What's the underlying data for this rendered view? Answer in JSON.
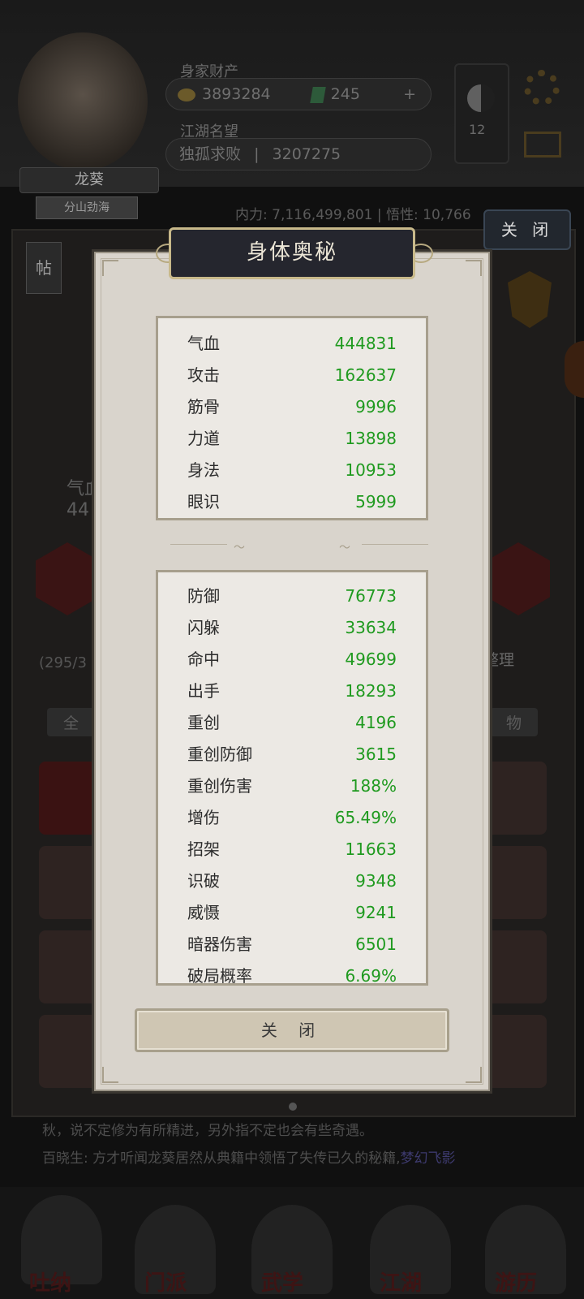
{
  "background": {
    "hero_name": "龙葵",
    "hero_tag": "分山劲海",
    "wealth_label": "身家财产",
    "coins": "3893284",
    "gems": "245",
    "plus": "+",
    "rep_label": "江湖名望",
    "rep_title": "独孤求败",
    "rep_value": "3207275",
    "level": "12",
    "power_line": "内力: 7,116,499,801 | 悟性: 10,766",
    "close_button": "关 闭",
    "sticker": "帖",
    "qi_label": "气血",
    "qi_value": "44",
    "bag_count": "(295/3",
    "tidy_button": "整理",
    "tab_all": "全",
    "tab_item": "物",
    "chat_line1": "秋，说不定修为有所精进，另外指不定也会有些奇遇。",
    "chat_line2_prefix": "百晓生: 方才听闻龙葵居然从典籍中领悟了失传已久的秘籍,",
    "chat_line2_link": "梦幻飞影",
    "nav": [
      "吐纳",
      "门派",
      "武学",
      "江湖",
      "游历"
    ]
  },
  "modal": {
    "title": "身体奥秘",
    "top_stats": [
      {
        "name": "气血",
        "value": "444831"
      },
      {
        "name": "攻击",
        "value": "162637"
      },
      {
        "name": "筋骨",
        "value": "9996"
      },
      {
        "name": "力道",
        "value": "13898"
      },
      {
        "name": "身法",
        "value": "10953"
      },
      {
        "name": "眼识",
        "value": "5999"
      }
    ],
    "bottom_stats": [
      {
        "name": "防御",
        "value": "76773"
      },
      {
        "name": "闪躲",
        "value": "33634"
      },
      {
        "name": "命中",
        "value": "49699"
      },
      {
        "name": "出手",
        "value": "18293"
      },
      {
        "name": "重创",
        "value": "4196"
      },
      {
        "name": "重创防御",
        "value": "3615"
      },
      {
        "name": "重创伤害",
        "value": "188%"
      },
      {
        "name": "增伤",
        "value": "65.49%"
      },
      {
        "name": "招架",
        "value": "11663"
      },
      {
        "name": "识破",
        "value": "9348"
      },
      {
        "name": "威慑",
        "value": "9241"
      },
      {
        "name": "暗器伤害",
        "value": "6501"
      },
      {
        "name": "破局概率",
        "value": "6.69%"
      }
    ],
    "close_label": "关 闭"
  },
  "colors": {
    "stat_value_green": "#1f9a1f",
    "modal_bg": "#d9d4cc",
    "title_plate": "#25262e"
  }
}
